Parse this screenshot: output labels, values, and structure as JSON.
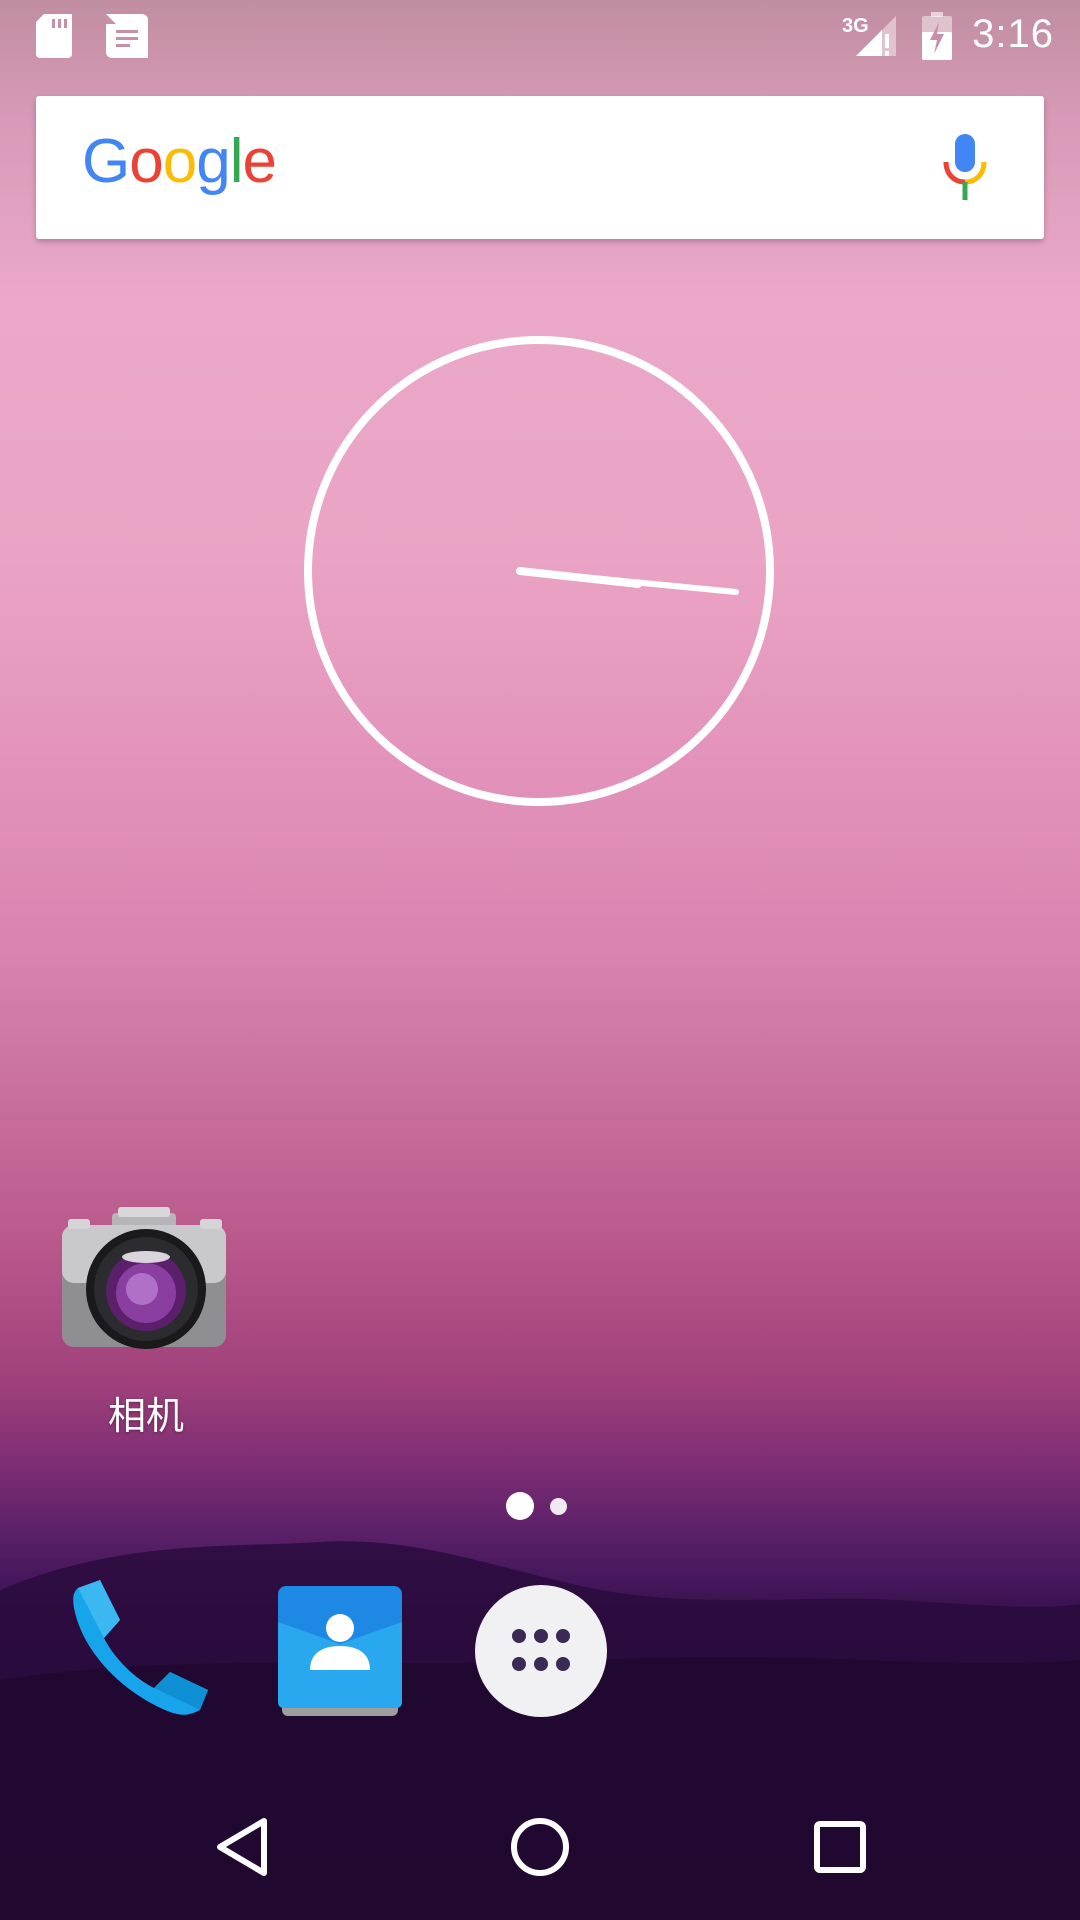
{
  "status_bar": {
    "time": "3:16",
    "network_label": "3G",
    "icons": [
      "sd-card-icon",
      "notification-message-icon",
      "signal-3g-icon",
      "battery-charging-icon"
    ]
  },
  "search": {
    "brand": [
      "G",
      "o",
      "o",
      "g",
      "l",
      "e"
    ],
    "brand_colors": [
      "#4285F4",
      "#EA4335",
      "#FBBC05",
      "#4285F4",
      "#34A853",
      "#EA4335"
    ],
    "mic_icon": "mic-icon"
  },
  "clock_widget": {
    "type": "analog-clock",
    "time": "3:16"
  },
  "apps": [
    {
      "label": "相机",
      "icon": "camera-icon"
    }
  ],
  "page_indicator": {
    "pages": 2,
    "current": 1
  },
  "dock": [
    {
      "name": "Phone",
      "icon": "phone-icon",
      "color": "#1EA7E9"
    },
    {
      "name": "Contacts",
      "icon": "contacts-icon",
      "color": "#1E88E5"
    },
    {
      "name": "All apps",
      "icon": "app-drawer-icon",
      "color": "#F1F1F3"
    }
  ],
  "nav_bar": {
    "buttons": [
      "back-icon",
      "home-icon",
      "recents-icon"
    ]
  },
  "colors": {
    "accent_white": "#FFFFFF",
    "dock_dots": "#3B2A55"
  }
}
